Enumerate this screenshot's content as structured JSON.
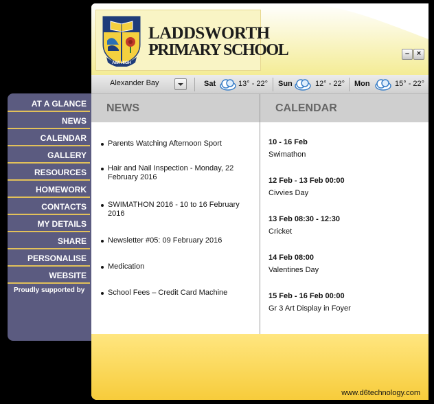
{
  "school": {
    "name_line1": "LADDSWORTH",
    "name_line2": "PRIMARY SCHOOL",
    "motto": "AIM HIGH"
  },
  "window_controls": {
    "minimize": "–",
    "close": "×"
  },
  "weather": {
    "location": "Alexander Bay",
    "days": [
      {
        "name": "Sat",
        "temp": "13° - 22°",
        "icon": "cloud-icon"
      },
      {
        "name": "Sun",
        "temp": "12° - 22°",
        "icon": "cloud-icon"
      },
      {
        "name": "Mon",
        "temp": "15° - 22°",
        "icon": "cloud-icon"
      }
    ]
  },
  "nav": {
    "items": [
      "AT A GLANCE",
      "NEWS",
      "CALENDAR",
      "GALLERY",
      "RESOURCES",
      "HOMEWORK",
      "CONTACTS",
      "MY DETAILS",
      "SHARE",
      "PERSONALISE",
      "WEBSITE"
    ],
    "supported": "Proudly supported by"
  },
  "news": {
    "title": "NEWS",
    "items": [
      "Parents Watching Afternoon Sport",
      "Hair and Nail Inspection - Monday, 22 February 2016",
      "SWIMATHON 2016 - 10 to 16 February 2016",
      "Newsletter #05: 09 February 2016",
      "Medication",
      "School Fees – Credit Card Machine"
    ]
  },
  "calendar": {
    "title": "CALENDAR",
    "events": [
      {
        "when": "10 - 16 Feb",
        "what": "Swimathon"
      },
      {
        "when": "12 Feb - 13 Feb 00:00",
        "what": "Civvies Day"
      },
      {
        "when": "13 Feb 08:30 - 12:30",
        "what": "Cricket"
      },
      {
        "when": "14 Feb 08:00",
        "what": "Valentines Day"
      },
      {
        "when": "15 Feb - 16 Feb 00:00",
        "what": "Gr 3 Art Display in Foyer"
      }
    ]
  },
  "footer": {
    "link": "www.d6technology.com"
  },
  "colors": {
    "accent_yellow": "#f7cc3b",
    "nav_bg": "#5b5b80",
    "nav_divider": "#e2c15a",
    "panel_header": "#cfcfcf"
  }
}
